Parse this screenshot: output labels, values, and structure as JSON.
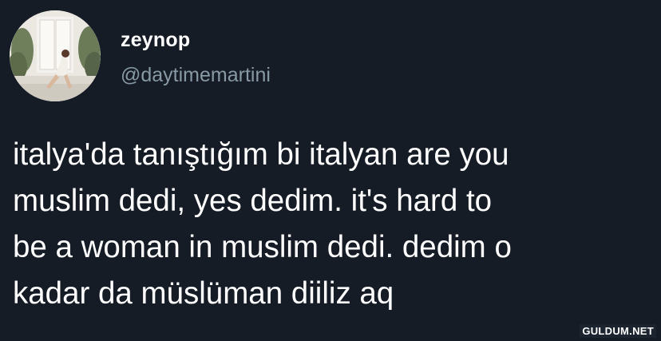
{
  "tweet": {
    "display_name": "zeynop",
    "handle": "@daytimemartini",
    "text": "italya'da tanıştığım bi italyan are you\nmuslim dedi, yes dedim. it's hard to\nbe a woman in muslim dedi. dedim o\nkadar da müslüman diiliz aq",
    "avatar_icon": "profile-photo"
  },
  "watermark": {
    "label": "GULDUM.NET"
  },
  "colors": {
    "background": "#151c26",
    "name": "#ffffff",
    "handle": "#8899a6",
    "text": "#ffffff"
  }
}
